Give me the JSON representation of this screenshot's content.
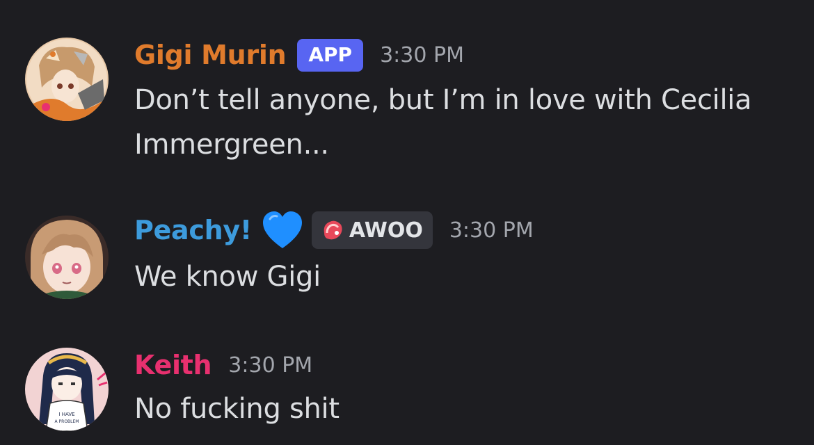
{
  "messages": [
    {
      "author": "Gigi Murin",
      "author_color": "#e07b2c",
      "tag": "APP",
      "timestamp": "3:30 PM",
      "text": "Don’t tell anyone, but I’m in love with Cecilia Immergreen..."
    },
    {
      "author": "Peachy!",
      "author_color": "#3d9bdc",
      "emoji": "blue-heart-icon",
      "guild_tag": "AWOO",
      "timestamp": "3:30 PM",
      "text": "We know Gigi"
    },
    {
      "author": "Keith",
      "author_color": "#e8306f",
      "timestamp": "3:30 PM",
      "text": "No fucking shit",
      "avatar_shirt_text": "I HAVE A PROBLEM"
    }
  ]
}
